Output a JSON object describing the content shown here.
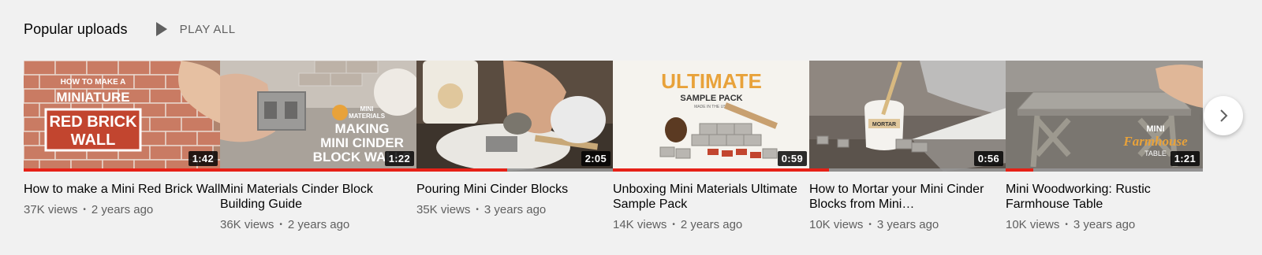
{
  "shelf": {
    "title": "Popular uploads",
    "play_all_label": "PLAY ALL",
    "play_icon": "play-icon",
    "next_icon": "chevron-right-icon"
  },
  "videos": [
    {
      "title": "How to make a Mini Red Brick Wall",
      "views": "37K views",
      "age": "2 years ago",
      "duration": "1:42",
      "watched_fraction": 1.0,
      "thumb_text": [
        "HOW TO MAKE A",
        "MINIATURE",
        "RED BRICK",
        "WALL"
      ]
    },
    {
      "title": "Mini Materials Cinder Block Building Guide",
      "views": "36K views",
      "age": "2 years ago",
      "duration": "1:22",
      "watched_fraction": 1.0,
      "thumb_text": [
        "MINI",
        "MATERIALS",
        "MAKING",
        "MINI CINDER",
        "BLOCK WALLS"
      ]
    },
    {
      "title": "Pouring Mini Cinder Blocks",
      "views": "35K views",
      "age": "3 years ago",
      "duration": "2:05",
      "watched_fraction": 0.46,
      "thumb_text": []
    },
    {
      "title": "Unboxing Mini Materials Ultimate Sample Pack",
      "views": "14K views",
      "age": "2 years ago",
      "duration": "0:59",
      "watched_fraction": 1.0,
      "thumb_text": [
        "ULTIMATE",
        "SAMPLE PACK",
        "MADE IN THE USA"
      ]
    },
    {
      "title": "How to Mortar your Mini Cinder Blocks from Mini…",
      "views": "10K views",
      "age": "3 years ago",
      "duration": "0:56",
      "watched_fraction": 0.1,
      "thumb_text": [
        "MORTAR"
      ]
    },
    {
      "title": "Mini Woodworking: Rustic Farmhouse Table",
      "views": "10K views",
      "age": "3 years ago",
      "duration": "1:21",
      "watched_fraction": 0.14,
      "thumb_text": [
        "MINI",
        "Farmhouse",
        "TABLE"
      ]
    }
  ],
  "colors": {
    "progress": "#e62117",
    "accent_orange": "#e8a23a",
    "brick_red": "#c2452f"
  }
}
